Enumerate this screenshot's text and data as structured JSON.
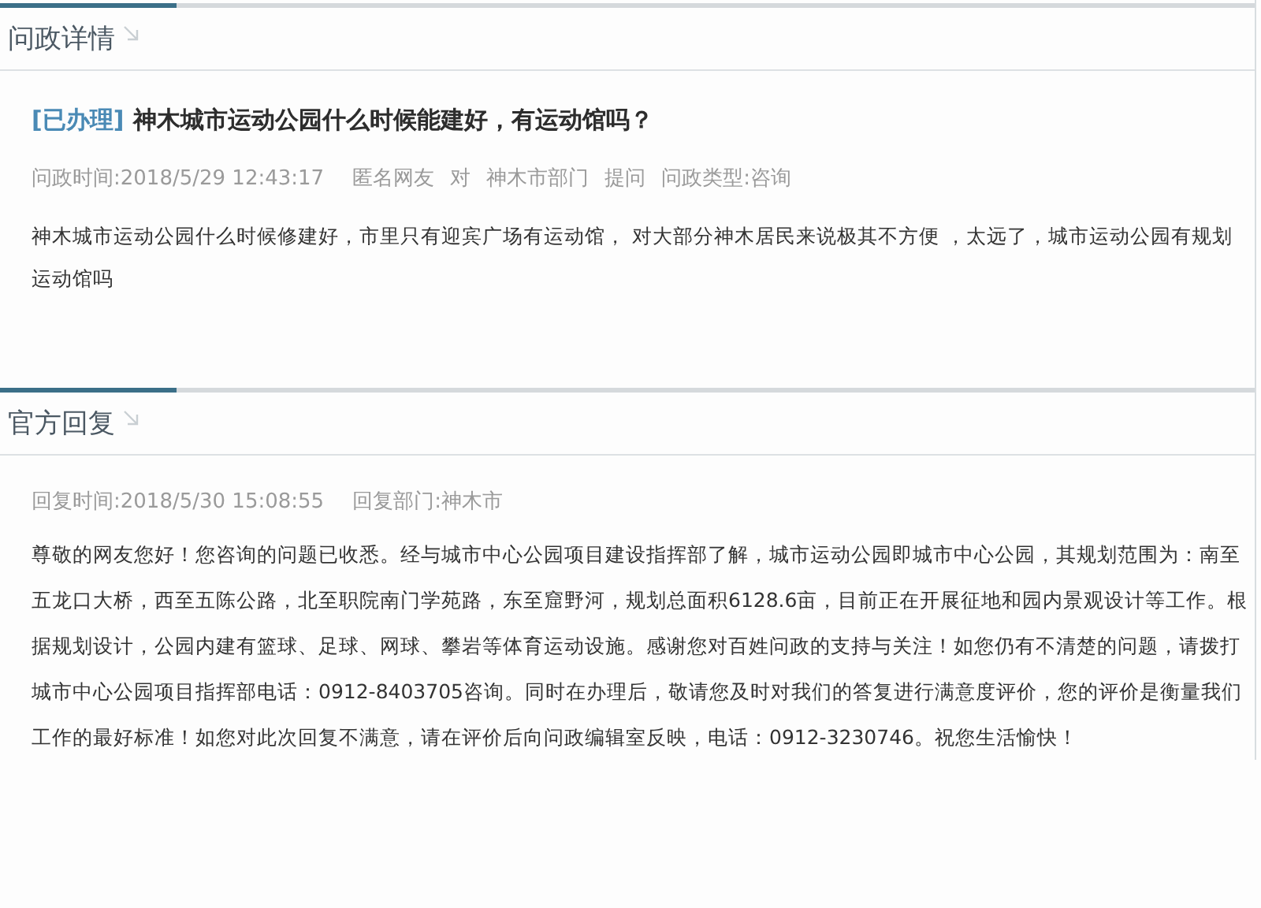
{
  "sections": [
    {
      "title": "问政详情",
      "status": "[已办理]",
      "heading": "神木城市运动公园什么时候能建好，有运动馆吗？",
      "meta": [
        "问政时间:2018/5/29 12:43:17",
        "匿名网友",
        "对",
        "神木市部门",
        "提问",
        "问政类型:咨询"
      ],
      "body": "神木城市运动公园什么时候修建好，市里只有迎宾广场有运动馆， 对大部分神木居民来说极其不方便 ，太远了，城市运动公园有规划运动馆吗"
    },
    {
      "title": "官方回复",
      "meta": [
        "回复时间:2018/5/30 15:08:55",
        "回复部门:神木市"
      ],
      "body": "尊敬的网友您好！您咨询的问题已收悉。经与城市中心公园项目建设指挥部了解，城市运动公园即城市中心公园，其规划范围为：南至五龙口大桥，西至五陈公路，北至职院南门学苑路，东至窟野河，规划总面积6128.6亩，目前正在开展征地和园内景观设计等工作。根据规划设计，公园内建有篮球、足球、网球、攀岩等体育运动设施。感谢您对百姓问政的支持与关注！如您仍有不清楚的问题，请拨打城市中心公园项目指挥部电话：0912-8403705咨询。同时在办理后，敬请您及时对我们的答复进行满意度评价，您的评价是衡量我们工作的最好标准！如您对此次回复不满意，请在评价后向问政编辑室反映，电话：0912-3230746。祝您生活愉快！"
    }
  ]
}
